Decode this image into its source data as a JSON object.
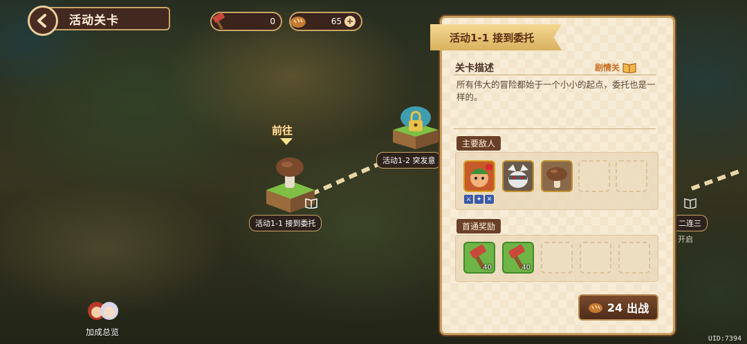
{
  "header": {
    "title": "活动关卡"
  },
  "resources": [
    {
      "icon": "hammer-icon",
      "value": "0"
    },
    {
      "icon": "bread-icon",
      "value": "65"
    }
  ],
  "map": {
    "goto_label": "前往",
    "nodes": [
      {
        "label": "活动1-1  接到委托"
      },
      {
        "label": "活动1-2  突发意"
      }
    ],
    "side_labels": [
      "二连三",
      "开启"
    ]
  },
  "panel": {
    "stage_title": "活动1-1  接到委托",
    "description_title": "关卡描述",
    "story_tag": "剧情关",
    "description": "所有伟大的冒险都始于一个小小的起点，委托也是一样的。",
    "enemies_title": "主要敌人",
    "enemies": [
      {
        "icon": "boss-monster-icon"
      },
      {
        "icon": "grey-wolf-icon"
      },
      {
        "icon": "mushroom-icon"
      }
    ],
    "rewards_title": "首通奖励",
    "rewards": [
      {
        "icon": "hammer-item-icon",
        "count": "40"
      },
      {
        "icon": "hammer-item-icon",
        "count": "40"
      }
    ],
    "fight": {
      "cost": "24",
      "label": "出战"
    }
  },
  "bonus": {
    "label": "加成总览"
  },
  "uid": "UID:7394"
}
